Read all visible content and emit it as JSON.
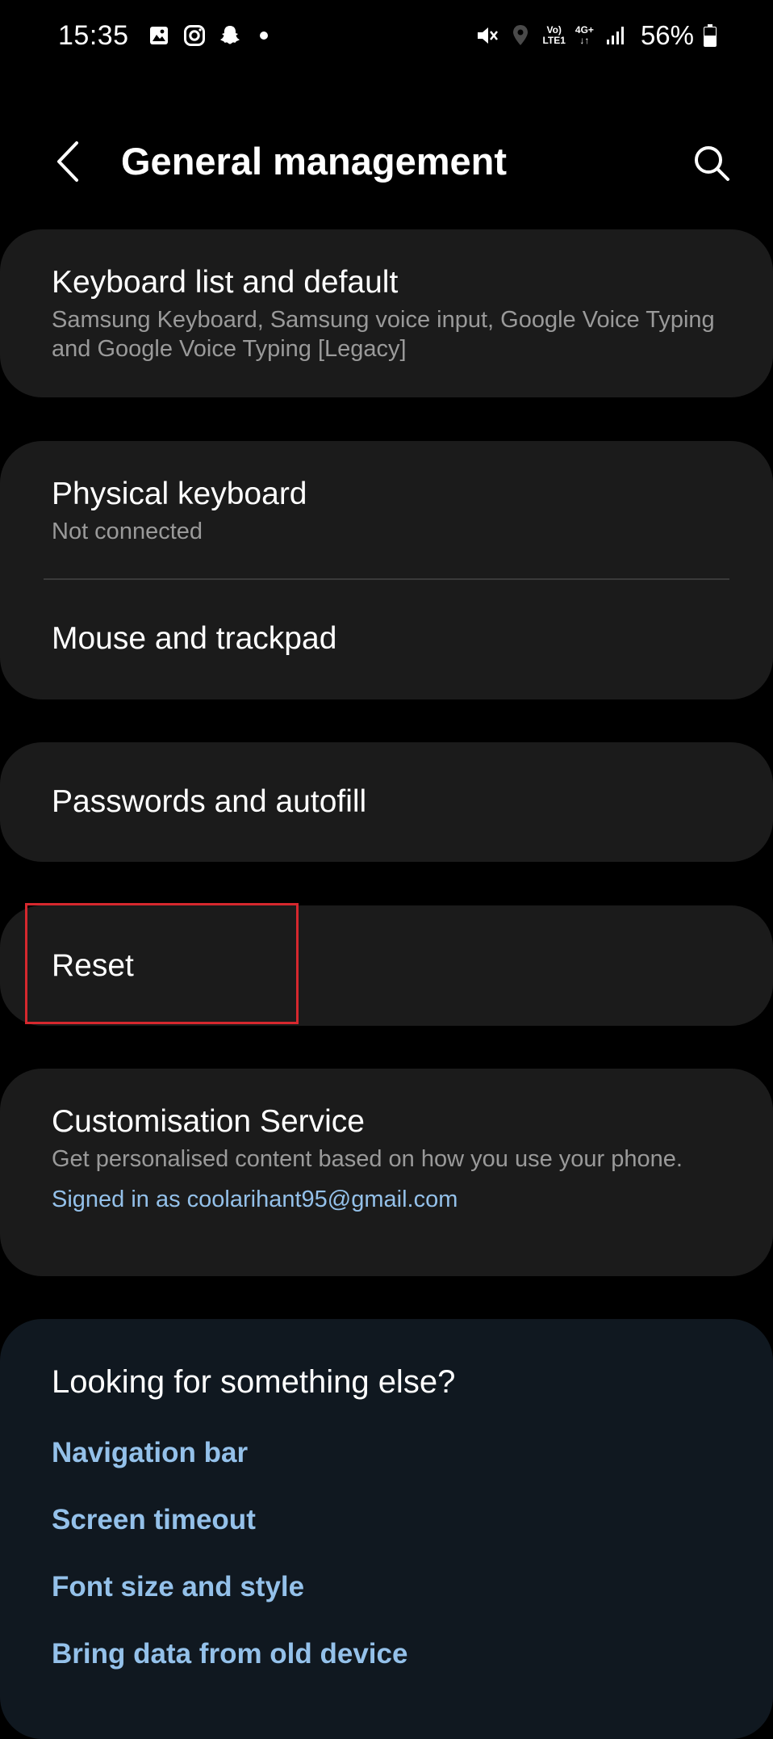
{
  "status_bar": {
    "time": "15:35",
    "left_icons": [
      "gallery-icon",
      "instagram-icon",
      "snapchat-icon",
      "notification-dot-icon"
    ],
    "right_icons": [
      "mute-icon",
      "location-icon",
      "volte-icon",
      "data-4g-icon",
      "signal-icon"
    ],
    "volte_line1": "Vo)",
    "volte_line2": "LTE1",
    "net_line1": "4G+",
    "net_line2": "↓↑",
    "battery_level": 0.56,
    "battery_text": "56%"
  },
  "header": {
    "title": "General management",
    "back_icon": "chevron-left-icon",
    "search_icon": "search-icon"
  },
  "items": {
    "keyboard_list": {
      "title": "Keyboard list and default",
      "subtitle": "Samsung Keyboard, Samsung voice input, Google Voice Typing and Google Voice Typing [Legacy]"
    },
    "physical_keyboard": {
      "title": "Physical keyboard",
      "subtitle": "Not connected"
    },
    "mouse_trackpad": {
      "title": "Mouse and trackpad"
    },
    "passwords_autofill": {
      "title": "Passwords and autofill"
    },
    "reset": {
      "title": "Reset"
    },
    "customisation": {
      "title": "Customisation Service",
      "subtitle": "Get personalised content based on how you use your phone.",
      "account": "Signed in as coolarihant95@gmail.com"
    }
  },
  "suggestions": {
    "title": "Looking for something else?",
    "links": [
      "Navigation bar",
      "Screen timeout",
      "Font size and style",
      "Bring data from old device"
    ]
  },
  "colors": {
    "background": "#000000",
    "card": "#1b1b1b",
    "suggestion_card": "#101820",
    "link": "#94c1ea",
    "secondary_text": "#9a9a9a",
    "highlight": "#d6282e"
  }
}
